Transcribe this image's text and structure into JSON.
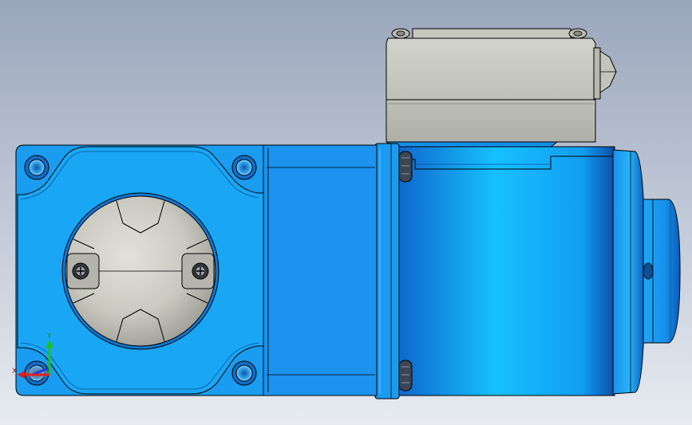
{
  "viewport": {
    "background_top": "#9aa6bc",
    "background_bottom": "#e7ebf1"
  },
  "model": {
    "body_color": "#1e90f0",
    "body_highlight": "#2fc4ff",
    "body_shadow": "#0b5fc0",
    "terminal_box_color": "#c4c6bf",
    "cap_color": "#cfcfc6",
    "edge_color": "#000000"
  },
  "triad": {
    "x_label": "X",
    "y_label": "Y",
    "x_color": "#e0201e",
    "y_color": "#1ec01e",
    "z_color": "#1e3ce0"
  }
}
